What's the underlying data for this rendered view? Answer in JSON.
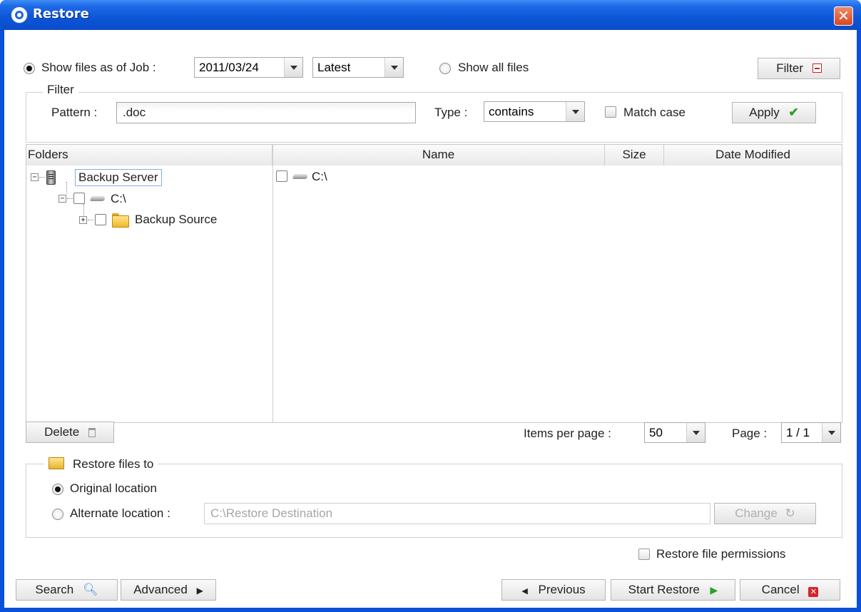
{
  "window": {
    "title": "Restore",
    "close_symbol": "✕"
  },
  "filter_bar": {
    "show_as_of_job_label": "Show files as of Job :",
    "job_date": "2011/03/24",
    "job_version": "Latest",
    "show_all_files_label": "Show all files",
    "filter_button_label": "Filter",
    "filter_button_icon": "minus-icon"
  },
  "filter_group": {
    "title": "Filter",
    "pattern_label": "Pattern :",
    "pattern_value": ".doc",
    "type_label": "Type :",
    "type_value": "contains",
    "match_case_label": "Match case",
    "apply_label": "Apply",
    "apply_icon": "check-icon"
  },
  "folders_panel": {
    "header": "Folders",
    "tree": [
      {
        "label": "Backup Server",
        "icon": "server-icon",
        "expanded": true
      },
      {
        "label": "C:\\",
        "icon": "drive-icon",
        "expanded": true
      },
      {
        "label": "Backup Source",
        "icon": "folder-icon",
        "expanded": false
      }
    ]
  },
  "files_table": {
    "columns": [
      "Name",
      "Size",
      "Date Modified"
    ],
    "rows": [
      {
        "name": "C:\\",
        "icon": "drive-icon"
      }
    ]
  },
  "pager": {
    "delete_label": "Delete",
    "items_per_page_label": "Items per page :",
    "items_per_page_value": "50",
    "page_label": "Page :",
    "page_value": "1 / 1"
  },
  "restore_to": {
    "title": "Restore files to",
    "original_label": "Original location",
    "alternate_label": "Alternate location :",
    "alternate_path": "C:\\Restore Destination",
    "change_label": "Change"
  },
  "restore_permissions_label": "Restore file permissions",
  "footer": {
    "search_label": "Search",
    "advanced_label": "Advanced",
    "previous_label": "Previous",
    "start_label": "Start Restore",
    "cancel_label": "Cancel"
  },
  "colors": {
    "title_bar": "#0a50d8",
    "accent_green": "#2aa12a",
    "cancel_red": "#d6242a",
    "search_blue": "#3c86d8"
  }
}
